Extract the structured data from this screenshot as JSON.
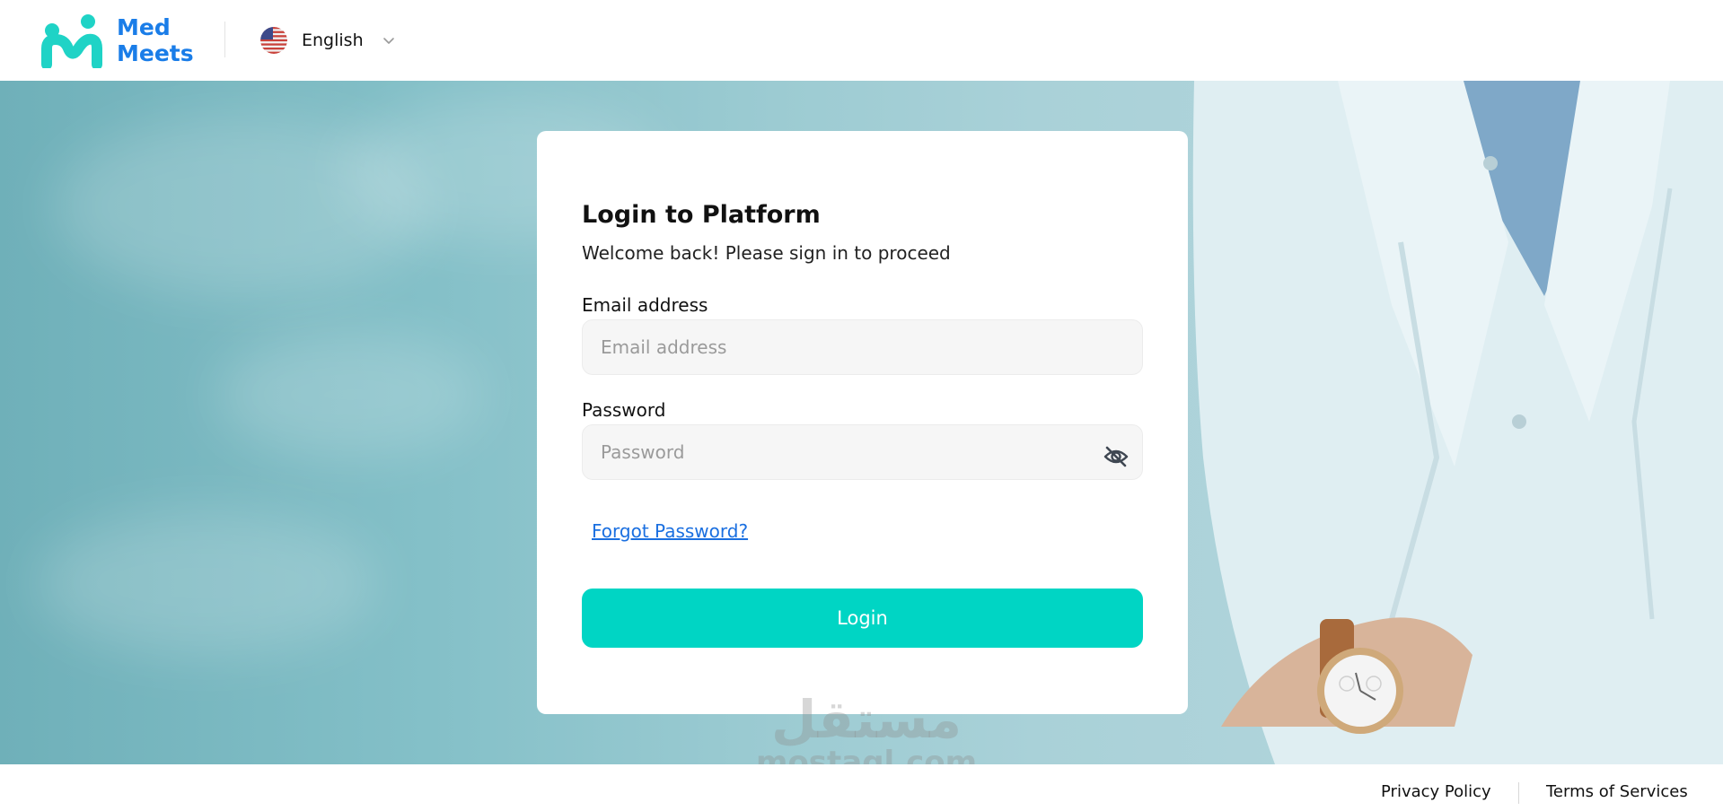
{
  "header": {
    "logo_line1": "Med",
    "logo_line2": "Meets",
    "language": "English",
    "flag_icon": "us-flag-icon",
    "chevron_icon": "chevron-down-icon"
  },
  "login": {
    "title": "Login to Platform",
    "subtitle": "Welcome back! Please sign in to proceed",
    "email_label": "Email address",
    "email_placeholder": "Email address",
    "password_label": "Password",
    "password_placeholder": "Password",
    "password_toggle_icon": "eye-off-icon",
    "forgot_label": "Forgot Password?",
    "login_label": "Login"
  },
  "watermark": {
    "arabic": "مستقل",
    "latin": "mostaql.com"
  },
  "footer": {
    "privacy": "Privacy Policy",
    "terms": "Terms of Services"
  },
  "colors": {
    "brand_blue": "#1a7de8",
    "brand_teal": "#1fd3c6",
    "login_button": "#00d5c4",
    "link": "#1a6fe0"
  }
}
